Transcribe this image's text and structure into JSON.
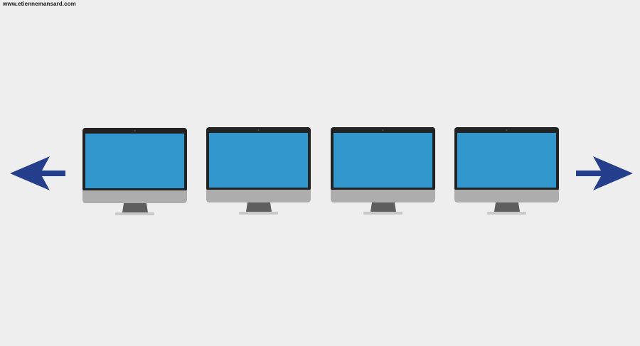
{
  "watermark": {
    "text": "www.etiennemansard.com"
  },
  "arrows": [
    {
      "direction": "left",
      "icon": "arrow-left-icon"
    },
    {
      "direction": "right",
      "icon": "arrow-right-icon"
    }
  ],
  "monitors": [
    {
      "screen_state": "blank"
    },
    {
      "screen_state": "blank"
    },
    {
      "screen_state": "blank"
    },
    {
      "screen_state": "blank"
    }
  ],
  "colors": {
    "background": "#EEEEEE",
    "arrow": "#263F8C",
    "screen": "#3197CC",
    "bezel": "#222222",
    "chin": "#ADADAD",
    "stand": "#5E5E5E",
    "base": "#C9C9C9"
  }
}
